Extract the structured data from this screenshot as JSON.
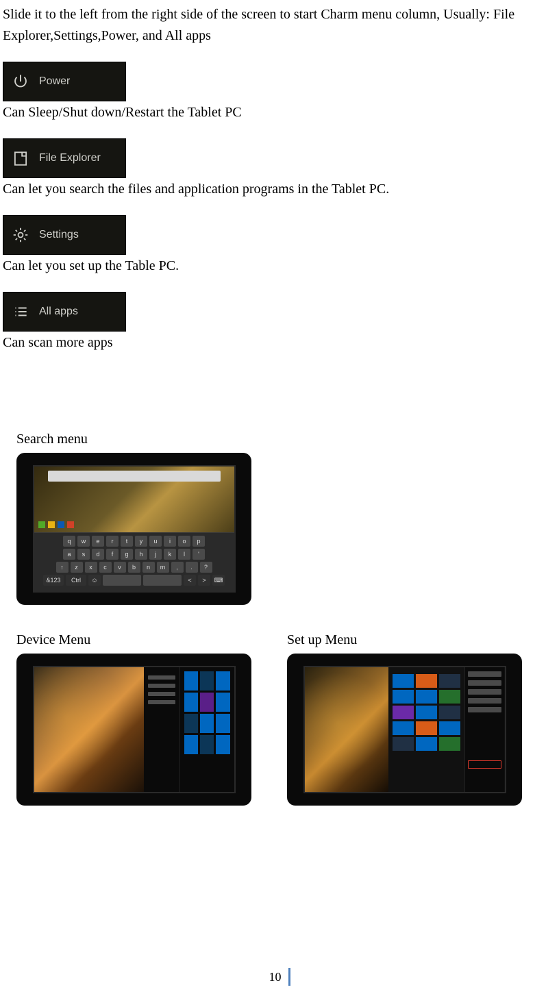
{
  "intro": {
    "line1": "Slide it to the left from the right side of the screen to start Charm menu column, Usually: File",
    "line2": "Explorer,Settings,Power, and All apps"
  },
  "charms": [
    {
      "icon": "power",
      "label": "Power",
      "desc": "Can Sleep/Shut down/Restart the Tablet PC"
    },
    {
      "icon": "file",
      "label": "File Explorer",
      "desc": "Can let you search the files and application programs in the Tablet PC."
    },
    {
      "icon": "gear",
      "label": "Settings",
      "desc": "Can let you set up the Table PC."
    },
    {
      "icon": "apps",
      "label": "All apps",
      "desc": "Can scan more apps"
    }
  ],
  "figures": {
    "search_label": "Search menu",
    "device_label": "Device Menu",
    "setup_label": "Set up Menu"
  },
  "keyboard_rows": [
    [
      "q",
      "w",
      "e",
      "r",
      "t",
      "y",
      "u",
      "i",
      "o",
      "p"
    ],
    [
      "a",
      "s",
      "d",
      "f",
      "g",
      "h",
      "j",
      "k",
      "l",
      "'"
    ],
    [
      "↑",
      "z",
      "x",
      "c",
      "v",
      "b",
      "n",
      "m",
      ",",
      ".",
      "?"
    ],
    [
      "&123",
      "Ctrl",
      "☺",
      "",
      "",
      "<",
      ">",
      "⌨"
    ]
  ],
  "page_number": "10"
}
